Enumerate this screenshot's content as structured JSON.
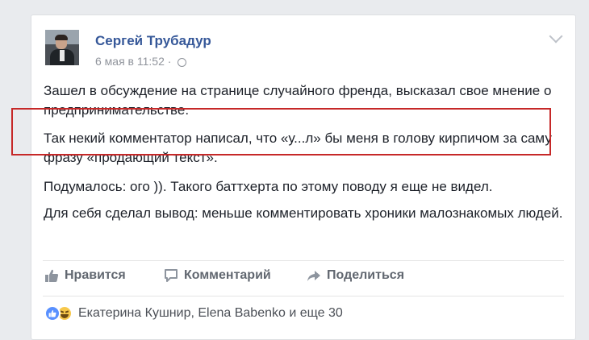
{
  "post": {
    "author": "Сергей Трубадур",
    "timestamp": "6 мая в 11:52 ·",
    "paragraphs": [
      "Зашел в обсуждение на странице случайного френда, высказал свое мнение о предпринимательстве.",
      "Так некий комментатор написал, что «у...л» бы меня в голову кирпичом за саму фразу «продающий текст».",
      "Подумалось: ого )). Такого баттхерта по этому поводу я еще не видел.",
      "Для себя сделал вывод: меньше комментировать хроники малознакомых людей."
    ],
    "privacy_icon": "globe-icon",
    "highlight_color": "#c62828"
  },
  "actions": {
    "like_label": "Нравится",
    "comment_label": "Комментарий",
    "share_label": "Поделиться"
  },
  "reactions": {
    "icons": [
      "like-reaction-icon",
      "haha-reaction-icon"
    ],
    "summary": "Екатерина Кушнир, Elena Babenko и еще 30"
  },
  "colors": {
    "author_link": "#365899",
    "meta_text": "#90949c",
    "action_text": "#616770",
    "like_blue": "#5890ff"
  }
}
